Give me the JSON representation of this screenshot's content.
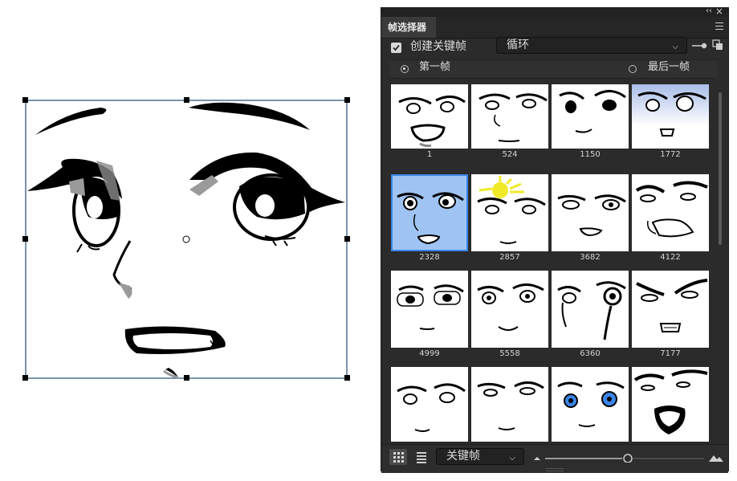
{
  "panel": {
    "title": "帧选择器",
    "collapse_glyph": "‹‹",
    "close_glyph": "×",
    "keyframe_only_label": "创建关键帧",
    "loop_value": "循环",
    "first_frame_label": "第一帧",
    "last_frame_label": "最后一帧",
    "view_mode_value": "关键帧"
  },
  "frames": [
    {
      "label": "1"
    },
    {
      "label": "524"
    },
    {
      "label": "1150"
    },
    {
      "label": "1772"
    },
    {
      "label": "2328"
    },
    {
      "label": "2857"
    },
    {
      "label": "3682"
    },
    {
      "label": "4122"
    },
    {
      "label": "4999"
    },
    {
      "label": "5558"
    },
    {
      "label": "6360"
    },
    {
      "label": "7177"
    },
    {
      "label": ""
    },
    {
      "label": ""
    },
    {
      "label": ""
    },
    {
      "label": ""
    }
  ],
  "selected_frame": "2328",
  "colors": {
    "selection": "#3b86e8",
    "panel_bg": "#2b2b2b",
    "handle": "#000000",
    "bbox": "#1f4e79"
  },
  "icons": {
    "checkbox": "check-icon",
    "menu": "hamburger-menu-icon",
    "pin": "pin-icon",
    "copy": "copy-icon",
    "grid": "grid-view-icon",
    "list": "list-view-icon",
    "zoom_small": "small-mountain-icon",
    "zoom_large": "large-mountain-icon"
  }
}
